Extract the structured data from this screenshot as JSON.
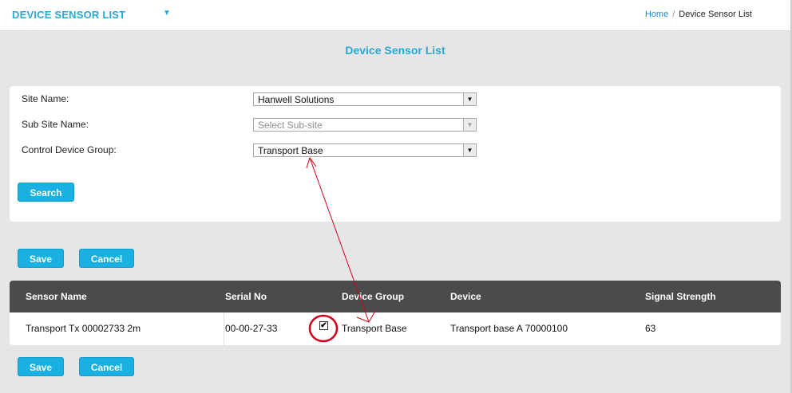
{
  "header": {
    "app_title": "DEVICE SENSOR LIST",
    "menu_caret": "▼",
    "breadcrumb": {
      "home": "Home",
      "separator": "/",
      "current": "Device Sensor List"
    }
  },
  "page": {
    "title": "Device Sensor List"
  },
  "filters": {
    "site_name": {
      "label": "Site Name:",
      "value": "Hanwell Solutions"
    },
    "sub_site_name": {
      "label": "Sub Site Name:",
      "value": "Select Sub-site",
      "disabled": true
    },
    "control_device_group": {
      "label": "Control Device Group:",
      "value": "Transport Base"
    },
    "search_label": "Search"
  },
  "actions": {
    "save_label": "Save",
    "cancel_label": "Cancel"
  },
  "table": {
    "columns": [
      "Sensor Name",
      "Serial No",
      "Device Group",
      "Device",
      "Signal Strength"
    ],
    "rows": [
      {
        "sensor_name": "Transport Tx 00002733 2m",
        "serial_no": "00-00-27-33",
        "device_group_checked": true,
        "checkbox_mark": "✔",
        "device_group": "Transport Base",
        "device": "Transport base A 70000100",
        "signal_strength": "63"
      }
    ]
  },
  "colors": {
    "accent": "#27a9d6",
    "button": "#1bb0e2",
    "table_header": "#4b4b4b",
    "annotation": "#d4001a"
  },
  "icons": {
    "dropdown": "triangle-down-icon",
    "checkbox": "check-icon"
  }
}
